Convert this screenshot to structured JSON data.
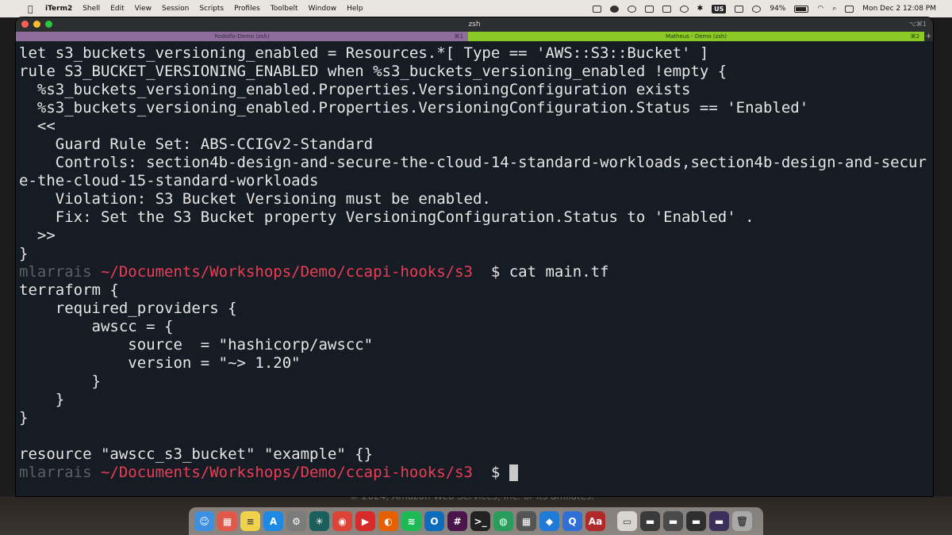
{
  "menubar": {
    "app_name": "iTerm2",
    "menus": [
      "Shell",
      "Edit",
      "View",
      "Session",
      "Scripts",
      "Profiles",
      "Toolbelt",
      "Window",
      "Help"
    ],
    "input_source": "US",
    "battery": "94%",
    "clock": "Mon Dec 2  12:08 PM"
  },
  "window": {
    "title": "zsh",
    "title_shortcut": "⌥⌘1",
    "tabs": [
      {
        "label": "Rodolfo-Demo (zsh)",
        "shortcut": "⌘1",
        "color": "#8d6c9c"
      },
      {
        "label": "Matheus - Demo (zsh)",
        "shortcut": "⌘2",
        "color": "#8ac926"
      }
    ],
    "new_tab": "+"
  },
  "terminal": {
    "lines": [
      "let s3_buckets_versioning_enabled = Resources.*[ Type == 'AWS::S3::Bucket' ]",
      "rule S3_BUCKET_VERSIONING_ENABLED when %s3_buckets_versioning_enabled !empty {",
      "  %s3_buckets_versioning_enabled.Properties.VersioningConfiguration exists",
      "  %s3_buckets_versioning_enabled.Properties.VersioningConfiguration.Status == 'Enabled'",
      "  <<",
      "    Guard Rule Set: ABS-CCIGv2-Standard",
      "    Controls: section4b-design-and-secure-the-cloud-14-standard-workloads,section4b-design-and-secur",
      "e-the-cloud-15-standard-workloads",
      "    Violation: S3 Bucket Versioning must be enabled.",
      "    Fix: Set the S3 Bucket property VersioningConfiguration.Status to 'Enabled' .",
      "  >>",
      "}"
    ],
    "prompt1": {
      "user": "mlarrais",
      "path": " ~/Documents/Workshops/Demo/ccapi-hooks/s3 ",
      "symbol": " $ ",
      "command": "cat main.tf"
    },
    "file_lines": [
      "terraform {",
      "    required_providers {",
      "        awscc = {",
      "            source  = \"hashicorp/awscc\"",
      "            version = \"~> 1.20\"",
      "        }",
      "    }",
      "}",
      "",
      "resource \"awscc_s3_bucket\" \"example\" {}"
    ],
    "prompt2": {
      "user": "mlarrais",
      "path": " ~/Documents/Workshops/Demo/ccapi-hooks/s3 ",
      "symbol": " $ "
    }
  },
  "background": {
    "footer_text": "© 2024, Amazon Web Services, Inc. or its affiliates."
  },
  "dock": {
    "apps": [
      {
        "icon": "finder-icon",
        "color": "#3d8fe0",
        "glyph": "☺"
      },
      {
        "icon": "launchpad-icon",
        "color": "#e0584a",
        "glyph": "▦"
      },
      {
        "icon": "notes-icon",
        "color": "#f1d24b",
        "glyph": "≡"
      },
      {
        "icon": "app-store-icon",
        "color": "#1e88e5",
        "glyph": "A"
      },
      {
        "icon": "system-settings-icon",
        "color": "#7b7b7b",
        "glyph": "⚙"
      },
      {
        "icon": "perplexity-icon",
        "color": "#1a5f5b",
        "glyph": "✳"
      },
      {
        "icon": "chrome-icon",
        "color": "#db4437",
        "glyph": "◉"
      },
      {
        "icon": "pdf-reader-icon",
        "color": "#d72b2b",
        "glyph": "▶"
      },
      {
        "icon": "firefox-icon",
        "color": "#e66000",
        "glyph": "◐"
      },
      {
        "icon": "spotify-icon",
        "color": "#1db954",
        "glyph": "≋"
      },
      {
        "icon": "outlook-icon",
        "color": "#0f6cbd",
        "glyph": "O"
      },
      {
        "icon": "slack-icon",
        "color": "#4a154b",
        "glyph": "#"
      },
      {
        "icon": "iterm-icon",
        "color": "#222222",
        "glyph": ">_"
      },
      {
        "icon": "globe-icon",
        "color": "#2a9d5c",
        "glyph": "◍"
      },
      {
        "icon": "calculator-icon",
        "color": "#555555",
        "glyph": "▦"
      },
      {
        "icon": "vscode-icon",
        "color": "#1f7ad8",
        "glyph": "◆"
      },
      {
        "icon": "quip-icon",
        "color": "#2f6fd6",
        "glyph": "Q"
      },
      {
        "icon": "dictionary-icon",
        "color": "#b02a2a",
        "glyph": "Aa"
      }
    ],
    "recent": [
      {
        "icon": "document-icon",
        "color": "#d9d6d2",
        "glyph": "▭"
      },
      {
        "icon": "window-thumbnail-icon",
        "color": "#3a3a3a",
        "glyph": "▬"
      },
      {
        "icon": "window-thumbnail-icon",
        "color": "#4a4a4a",
        "glyph": "▬"
      },
      {
        "icon": "window-thumbnail-icon",
        "color": "#2f2f2f",
        "glyph": "▬"
      },
      {
        "icon": "window-thumbnail-icon",
        "color": "#3b2f5c",
        "glyph": "▬"
      },
      {
        "icon": "trash-icon",
        "color": "#a9a9a9",
        "glyph": "🗑"
      }
    ]
  }
}
